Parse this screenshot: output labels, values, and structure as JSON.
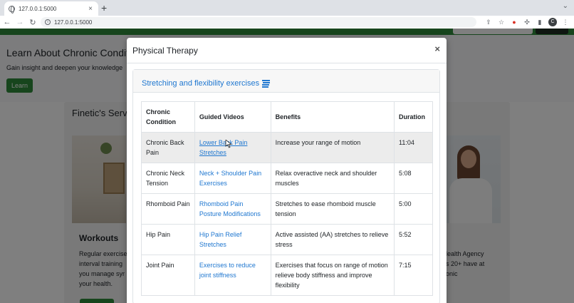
{
  "browser": {
    "tab_title": "127.0.0.1:5000",
    "tab_close": "×",
    "new_tab": "+",
    "url": "127.0.0.1:5000",
    "profile_initial": "C"
  },
  "page": {
    "hero_title": "Learn About Chronic Conditi",
    "hero_subtitle": "Gain insight and deepen your knowledge",
    "hero_button": "Learn",
    "services_title": "Finetic's Serv",
    "workouts_title": "Workouts",
    "workouts_text": "Regular exercise\ninterval training\nyou manage syr\nyour health.",
    "right_text": "lealth Agency\ns 20+ have at\nonic"
  },
  "modal": {
    "title": "Physical Therapy",
    "close_label": "×",
    "section_title": "Stretching and flexibility exercises",
    "table": {
      "headers": [
        "Chronic Condition",
        "Guided Videos",
        "Benefits",
        "Duration"
      ],
      "rows": [
        {
          "condition": "Chronic Back Pain",
          "video": "Lower Back Pain Stretches",
          "benefit": "Increase your range of motion",
          "duration": "11:04"
        },
        {
          "condition": "Chronic Neck Tension",
          "video": "Neck + Shoulder Pain Exercises",
          "benefit": "Relax overactive neck and shoulder muscles",
          "duration": "5:08"
        },
        {
          "condition": "Rhomboid Pain",
          "video": "Rhomboid Pain Posture Modifications",
          "benefit": "Stretches to ease rhomboid muscle tension",
          "duration": "5:00"
        },
        {
          "condition": "Hip Pain",
          "video": "Hip Pain Relief Stretches",
          "benefit": "Active assisted (AA) stretches to relieve stress",
          "duration": "5:52"
        },
        {
          "condition": "Joint Pain",
          "video": "Exercises to reduce joint stiffness",
          "benefit": "Exercises that focus on range of motion relieve body stiffness and improve flexibility",
          "duration": "7:15"
        }
      ]
    }
  },
  "colors": {
    "brand_green": "#2e8b3a",
    "link_blue": "#1f77d0"
  }
}
